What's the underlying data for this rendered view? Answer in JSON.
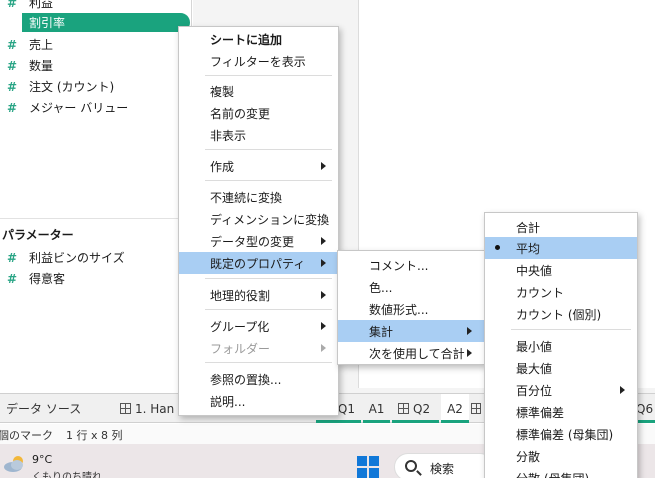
{
  "data_pane": {
    "fields": [
      {
        "label": "利益"
      },
      {
        "label": "割引率",
        "selected": true
      },
      {
        "label": "売上"
      },
      {
        "label": "数量"
      },
      {
        "label": "注文 (カウント)"
      },
      {
        "label": "メジャー バリュー"
      }
    ],
    "field_symbol": "#",
    "parameters_title": "パラメーター",
    "parameters": [
      {
        "label": "利益ビンのサイズ"
      },
      {
        "label": "得意客"
      }
    ]
  },
  "tabs": {
    "datasource": "データ ソース",
    "sheet1": "1. Han",
    "q1": "Q1",
    "a1": "A1",
    "q2": "Q2",
    "a2": "A2",
    "q6": "Q6"
  },
  "status": {
    "marks": "個のマーク",
    "rows": "1 行 x 8 列"
  },
  "taskbar": {
    "temperature": "9°C",
    "condition": "くもりのち晴れ",
    "search_placeholder": "検索"
  },
  "context_menu": {
    "items": [
      {
        "label": "シートに追加",
        "bold": true
      },
      {
        "label": "フィルターを表示"
      },
      {
        "label": "複製"
      },
      {
        "label": "名前の変更"
      },
      {
        "label": "非表示"
      },
      {
        "label": "作成",
        "submenu": true
      },
      {
        "label": "不連続に変換"
      },
      {
        "label": "ディメンションに変換"
      },
      {
        "label": "データ型の変更",
        "submenu": true
      },
      {
        "label": "既定のプロパティ",
        "submenu": true,
        "highlighted": true
      },
      {
        "label": "地理的役割",
        "submenu": true
      },
      {
        "label": "グループ化",
        "submenu": true
      },
      {
        "label": "フォルダー",
        "submenu": true,
        "disabled": true
      },
      {
        "label": "参照の置換..."
      },
      {
        "label": "説明..."
      }
    ]
  },
  "default_props_menu": {
    "items": [
      {
        "label": "コメント..."
      },
      {
        "label": "色..."
      },
      {
        "label": "数値形式..."
      },
      {
        "label": "集計",
        "submenu": true,
        "highlighted": true
      },
      {
        "label": "次を使用して合計",
        "submenu": true
      }
    ]
  },
  "aggregation_menu": {
    "items": [
      {
        "label": "合計"
      },
      {
        "label": "平均",
        "checked": true,
        "highlighted": true
      },
      {
        "label": "中央値"
      },
      {
        "label": "カウント"
      },
      {
        "label": "カウント (個別)"
      },
      {
        "label": "最小値"
      },
      {
        "label": "最大値"
      },
      {
        "label": "百分位",
        "submenu": true
      },
      {
        "label": "標準偏差"
      },
      {
        "label": "標準偏差 (母集団)"
      },
      {
        "label": "分散"
      },
      {
        "label": "分散 (母集団)"
      }
    ]
  },
  "colors": {
    "accent": "#1aa37e",
    "menu_highlight": "#a9cef3"
  }
}
